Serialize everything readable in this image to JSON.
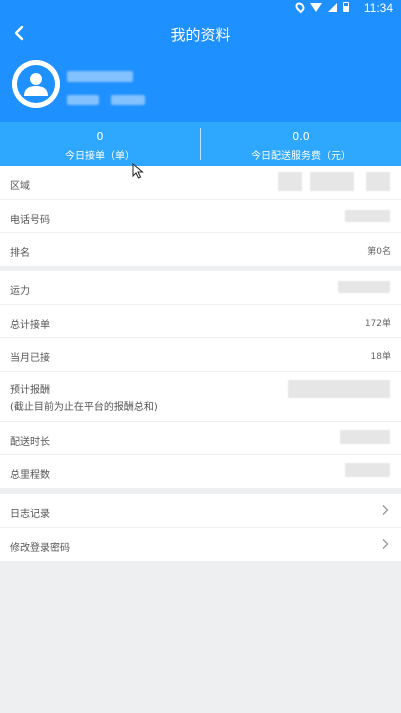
{
  "status_bar": {
    "time": "11:34"
  },
  "header": {
    "title": "我的资料"
  },
  "stats": [
    {
      "value": "0",
      "label": "今日接单（单）"
    },
    {
      "value": "0.0",
      "label": "今日配送服务费（元）"
    }
  ],
  "info_rows": [
    {
      "label": "区域",
      "value": ""
    },
    {
      "label": "电话号码",
      "value": ""
    },
    {
      "label": "排名",
      "value": "第0名"
    }
  ],
  "stat_rows": [
    {
      "label": "运力",
      "value": ""
    },
    {
      "label": "总计接单",
      "value": "172单"
    },
    {
      "label": "当月已接",
      "value": "18单"
    },
    {
      "label": "预计报酬",
      "sublabel": "(截止目前为止在平台的报酬总和)",
      "value": ""
    },
    {
      "label": "配送时长",
      "value": ""
    },
    {
      "label": "总里程数",
      "value": ""
    }
  ],
  "menu_rows": [
    {
      "label": "日志记录"
    },
    {
      "label": "修改登录密码"
    }
  ]
}
